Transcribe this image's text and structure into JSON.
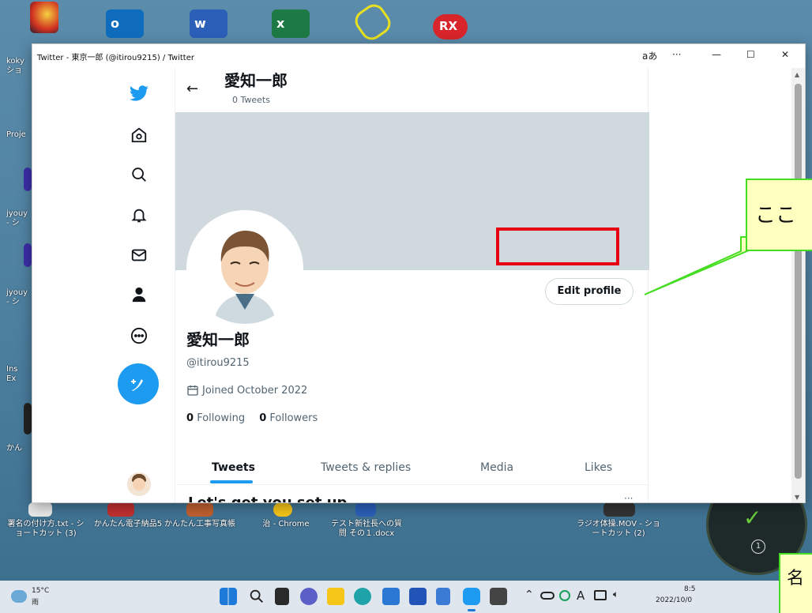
{
  "desktop": {
    "left_labels": [
      "koky",
      "ショ",
      "Proje",
      "jyouy",
      "- シ",
      "jyouy",
      "- シ",
      "Ins",
      "Ex",
      "かん"
    ],
    "bottom_icons": [
      {
        "label": "署名の付け方.txt - ショートカット (3)"
      },
      {
        "label": "かんたん電子納品5"
      },
      {
        "label": "かんたん工事写真帳"
      },
      {
        "label": "治 - Chrome"
      },
      {
        "label": "テスト新社長への質問 その１.docx"
      },
      {
        "label": "ラジオ体操.MOV - ショートカット (2)"
      }
    ]
  },
  "window": {
    "title": "Twitter - 東京一郎 (@itirou9215) / Twitter",
    "ime": "aあ",
    "more": "···",
    "minimize": "—",
    "maximize": "☐",
    "close": "✕"
  },
  "header": {
    "back": "←",
    "name": "愛知一郎",
    "tweet_count": "0 Tweets"
  },
  "profile": {
    "name": "愛知一郎",
    "handle": "@itirou9215",
    "joined": "Joined October 2022",
    "following_count": "0",
    "following_label": "Following",
    "followers_count": "0",
    "followers_label": "Followers",
    "edit_button": "Edit profile"
  },
  "tabs": [
    "Tweets",
    "Tweets & replies",
    "Media",
    "Likes"
  ],
  "setup_heading": "Let's get you set up",
  "callouts": {
    "top": "ここ",
    "bottom": "名"
  },
  "taskbar": {
    "temperature": "15°C",
    "weather": "雨",
    "ime_a": "A",
    "time": "8:5",
    "date": "2022/10/0"
  },
  "colors": {
    "accent": "#1d9bf0",
    "highlight": "#e60012",
    "callout_border": "#44dd22",
    "callout_fill": "#ffffc0"
  },
  "icons": [
    "home-icon",
    "explore-icon",
    "notifications-icon",
    "messages-icon",
    "profile-icon",
    "more-icon",
    "compose-icon"
  ]
}
